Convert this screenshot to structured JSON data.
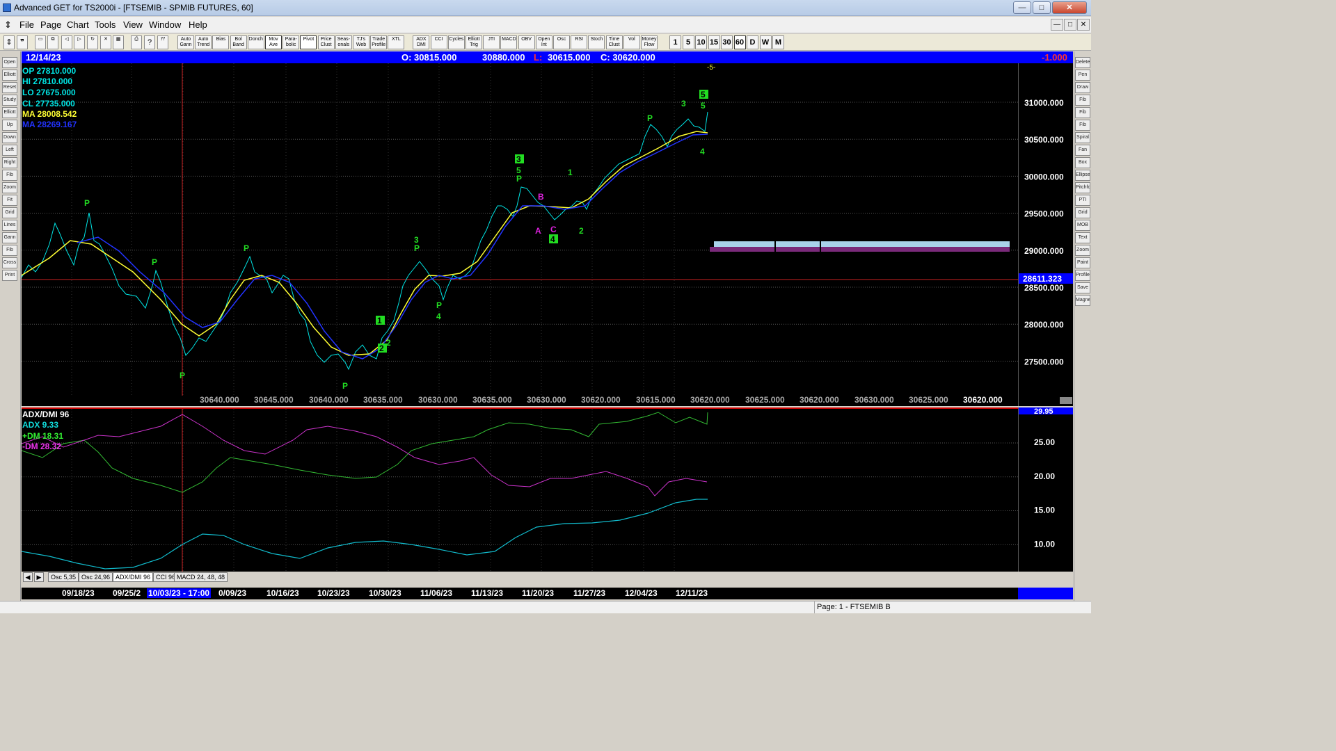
{
  "window": {
    "title": "Advanced GET for TS2000i - [FTSEMIB - SPMIB FUTURES, 60]",
    "minimize": "—",
    "maximize": "□",
    "close": "✕"
  },
  "menu": [
    "File",
    "Page",
    "Chart",
    "Tools",
    "View",
    "Window",
    "Help"
  ],
  "toolbar": {
    "studies": [
      "Auto Gann",
      "Auto Trend",
      "Bias",
      "Bol Band",
      "Donch",
      "Mov Ave",
      "Para- bolic",
      "Pivot",
      "Price Clust",
      "Seas- onals",
      "TJ's Web",
      "Trade Profile",
      "XTL",
      "ADX DMI",
      "CCI",
      "Cycles",
      "Elliott Trig",
      "JTI",
      "MACD",
      "OBV",
      "Open Int",
      "Osc",
      "RSI",
      "Stoch",
      "Time Clust",
      "Vol",
      "Money Flow"
    ],
    "intervals": [
      "1",
      "5",
      "10",
      "15",
      "30",
      "60",
      "D",
      "W",
      "M"
    ],
    "selected_interval": "60"
  },
  "left_tools": [
    "Open",
    "Elliott",
    "Reset",
    "Study",
    "Elliott",
    "Up",
    "Down",
    "Left",
    "Right",
    "Fib",
    "Zoom",
    "Fit",
    "Grid",
    "Lines",
    "Gann",
    "Fib",
    "Cross",
    "Print"
  ],
  "right_tools": [
    "Delete",
    "Pen",
    "Draw",
    "Fib Ret",
    "Fib Ext",
    "Fib Time",
    "Spiral",
    "Fan",
    "Box",
    "Ellipse",
    "Pitchfork",
    "PTI",
    "Grid",
    "MOB",
    "Text",
    "Zoom",
    "Paint",
    "Profile",
    "Save",
    "Magnet"
  ],
  "infobar": {
    "date": "12/14/23",
    "open": "O:  30815.000",
    "high": "30880.000",
    "low_label": "L:",
    "low": "30615.000",
    "close": "C:  30620.000",
    "change": "-1.000"
  },
  "legend": {
    "op": "OP  27810.000",
    "hi": "HI   27810.000",
    "lo": "LO  27675.000",
    "cl": "CL  27735.000",
    "ma1": "MA  28008.542",
    "ma2": "MA  28269.167"
  },
  "price_axis": {
    "labels": [
      "31000.000",
      "30500.000",
      "30000.000",
      "29500.000",
      "29000.000",
      "28500.000",
      "28000.000",
      "27500.000"
    ],
    "marker": "28611.323"
  },
  "bottom_values": [
    "30640.000",
    "30645.000",
    "30640.000",
    "30635.000",
    "30630.000",
    "30635.000",
    "30630.000",
    "30620.000",
    "30615.000",
    "30620.000",
    "30625.000",
    "30620.000",
    "30630.000",
    "30625.000",
    "30620.000"
  ],
  "wave_labels": {
    "p": "P",
    "one": "1",
    "two": "2",
    "three": "3",
    "four": "4",
    "five": "5",
    "a": "A",
    "b": "B",
    "c": "C",
    "top_marker": "-5-"
  },
  "oscillator": {
    "title": "ADX/DMI 96",
    "adx": "ADX 9.33",
    "pdm": "+DM 18.31",
    "mdm": "-DM 28.32",
    "axis": [
      "25.00",
      "20.00",
      "15.00",
      "10.00"
    ],
    "marker": "29.95"
  },
  "tabs": [
    "Osc 5,35",
    "Osc 24,96",
    "ADX/DMI 96",
    "CCI 96",
    "MACD 24, 48, 48"
  ],
  "selected_tab": "ADX/DMI 96",
  "dates": [
    "09/18/23",
    "09/25/2",
    "10/03/23 - 17:00",
    "0/09/23",
    "10/16/23",
    "10/23/23",
    "10/30/23",
    "11/06/23",
    "11/13/23",
    "11/20/23",
    "11/27/23",
    "12/04/23",
    "12/11/23"
  ],
  "status": {
    "page": "Page: 1 - FTSEMIB B"
  },
  "colors": {
    "price": "#00e5e5",
    "ma_fast": "#ffff33",
    "ma_slow": "#2233ff",
    "wave": "#22dd22",
    "corrective": "#dd22dd",
    "adx": "#11bbcc",
    "pdm": "#33bb33",
    "mdm": "#cc33cc",
    "infobar": "#0000ff"
  }
}
